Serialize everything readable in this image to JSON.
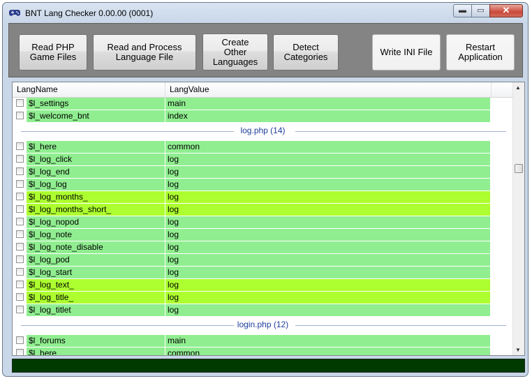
{
  "window": {
    "title": "BNT Lang Checker 0.00.00 (0001)"
  },
  "titlebar_buttons": {
    "minimize": "▬",
    "maximize": "▭",
    "close": "✕"
  },
  "toolbar": {
    "read_php": "Read PHP\nGame Files",
    "read_process": "Read and Process\nLanguage File",
    "create_other": "Create\nOther\nLanguages",
    "detect_categories": "Detect\nCategories",
    "write_ini": "Write INI File",
    "restart": "Restart\nApplication"
  },
  "list": {
    "columns": [
      "LangName",
      "LangValue"
    ],
    "top_rows": [
      {
        "name": "$l_settings",
        "value": "main",
        "color": "#90ee90"
      },
      {
        "name": "$l_welcome_bnt",
        "value": "index",
        "color": "#90ee90"
      }
    ],
    "groups": [
      {
        "label": "log.php (14)",
        "rows": [
          {
            "name": "$l_here",
            "value": "common",
            "color": "#90ee90"
          },
          {
            "name": "$l_log_click",
            "value": "log",
            "color": "#90ee90"
          },
          {
            "name": "$l_log_end",
            "value": "log",
            "color": "#90ee90"
          },
          {
            "name": "$l_log_log",
            "value": "log",
            "color": "#90ee90"
          },
          {
            "name": "$l_log_months_",
            "value": "log",
            "color": "#adff2f"
          },
          {
            "name": "$l_log_months_short_",
            "value": "log",
            "color": "#adff2f"
          },
          {
            "name": "$l_log_nopod",
            "value": "log",
            "color": "#90ee90"
          },
          {
            "name": "$l_log_note",
            "value": "log",
            "color": "#90ee90"
          },
          {
            "name": "$l_log_note_disable",
            "value": "log",
            "color": "#90ee90"
          },
          {
            "name": "$l_log_pod",
            "value": "log",
            "color": "#90ee90"
          },
          {
            "name": "$l_log_start",
            "value": "log",
            "color": "#90ee90"
          },
          {
            "name": "$l_log_text_",
            "value": "log",
            "color": "#adff2f"
          },
          {
            "name": "$l_log_title_",
            "value": "log",
            "color": "#adff2f"
          },
          {
            "name": "$l_log_titlet",
            "value": "log",
            "color": "#90ee90"
          }
        ]
      },
      {
        "label": "login.php (12)",
        "rows": [
          {
            "name": "$l_forums",
            "value": "main",
            "color": "#90ee90"
          },
          {
            "name": "$l_here",
            "value": "common",
            "color": "#90ee90"
          }
        ]
      }
    ]
  },
  "scrollbar": {
    "up": "▲",
    "down": "▼"
  },
  "colors": {
    "status_bar": "#003a00",
    "group_label": "#1e3d9c",
    "row_green": "#90ee90",
    "row_yellowgreen": "#adff2f"
  }
}
